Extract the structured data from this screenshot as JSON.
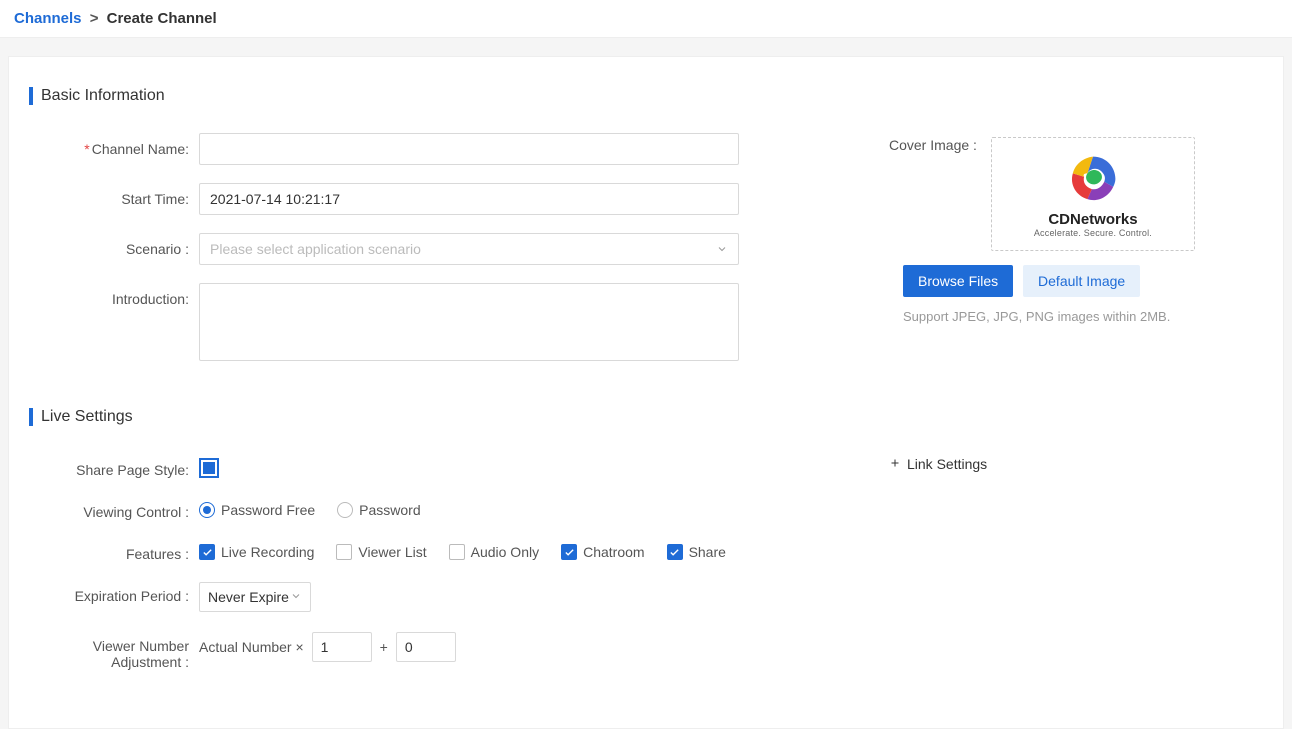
{
  "breadcrumb": {
    "root": "Channels",
    "sep": ">",
    "current": "Create Channel"
  },
  "sections": {
    "basic": "Basic Information",
    "live": "Live Settings"
  },
  "labels": {
    "channel_name": "Channel Name:",
    "start_time": "Start Time:",
    "scenario": "Scenario :",
    "introduction": "Introduction:",
    "cover_image": "Cover Image :",
    "share_page_style": "Share Page Style:",
    "viewing_control": "Viewing Control :",
    "features": "Features :",
    "expiration_period": "Expiration Period :",
    "viewer_number_adjustment_l1": "Viewer Number",
    "viewer_number_adjustment_l2": "Adjustment :"
  },
  "values": {
    "channel_name": "",
    "start_time": "2021-07-14 10:21:17",
    "scenario_placeholder": "Please select application scenario",
    "introduction": ""
  },
  "cover": {
    "logo_text": "CDNetworks",
    "logo_sub": "Accelerate. Secure. Control.",
    "browse": "Browse Files",
    "default": "Default Image",
    "hint": "Support JPEG, JPG, PNG images within 2MB."
  },
  "viewing_control": {
    "selected": "password_free",
    "password_free": "Password Free",
    "password": "Password"
  },
  "features": {
    "live_recording": {
      "label": "Live Recording",
      "checked": true
    },
    "viewer_list": {
      "label": "Viewer List",
      "checked": false
    },
    "audio_only": {
      "label": "Audio Only",
      "checked": false
    },
    "chatroom": {
      "label": "Chatroom",
      "checked": true
    },
    "share": {
      "label": "Share",
      "checked": true
    }
  },
  "expiration": {
    "selected": "Never Expire"
  },
  "viewer_adjust": {
    "prefix": "Actual Number ×",
    "mult": "1",
    "plus": "+",
    "add": "0"
  },
  "link_settings": "Link Settings"
}
